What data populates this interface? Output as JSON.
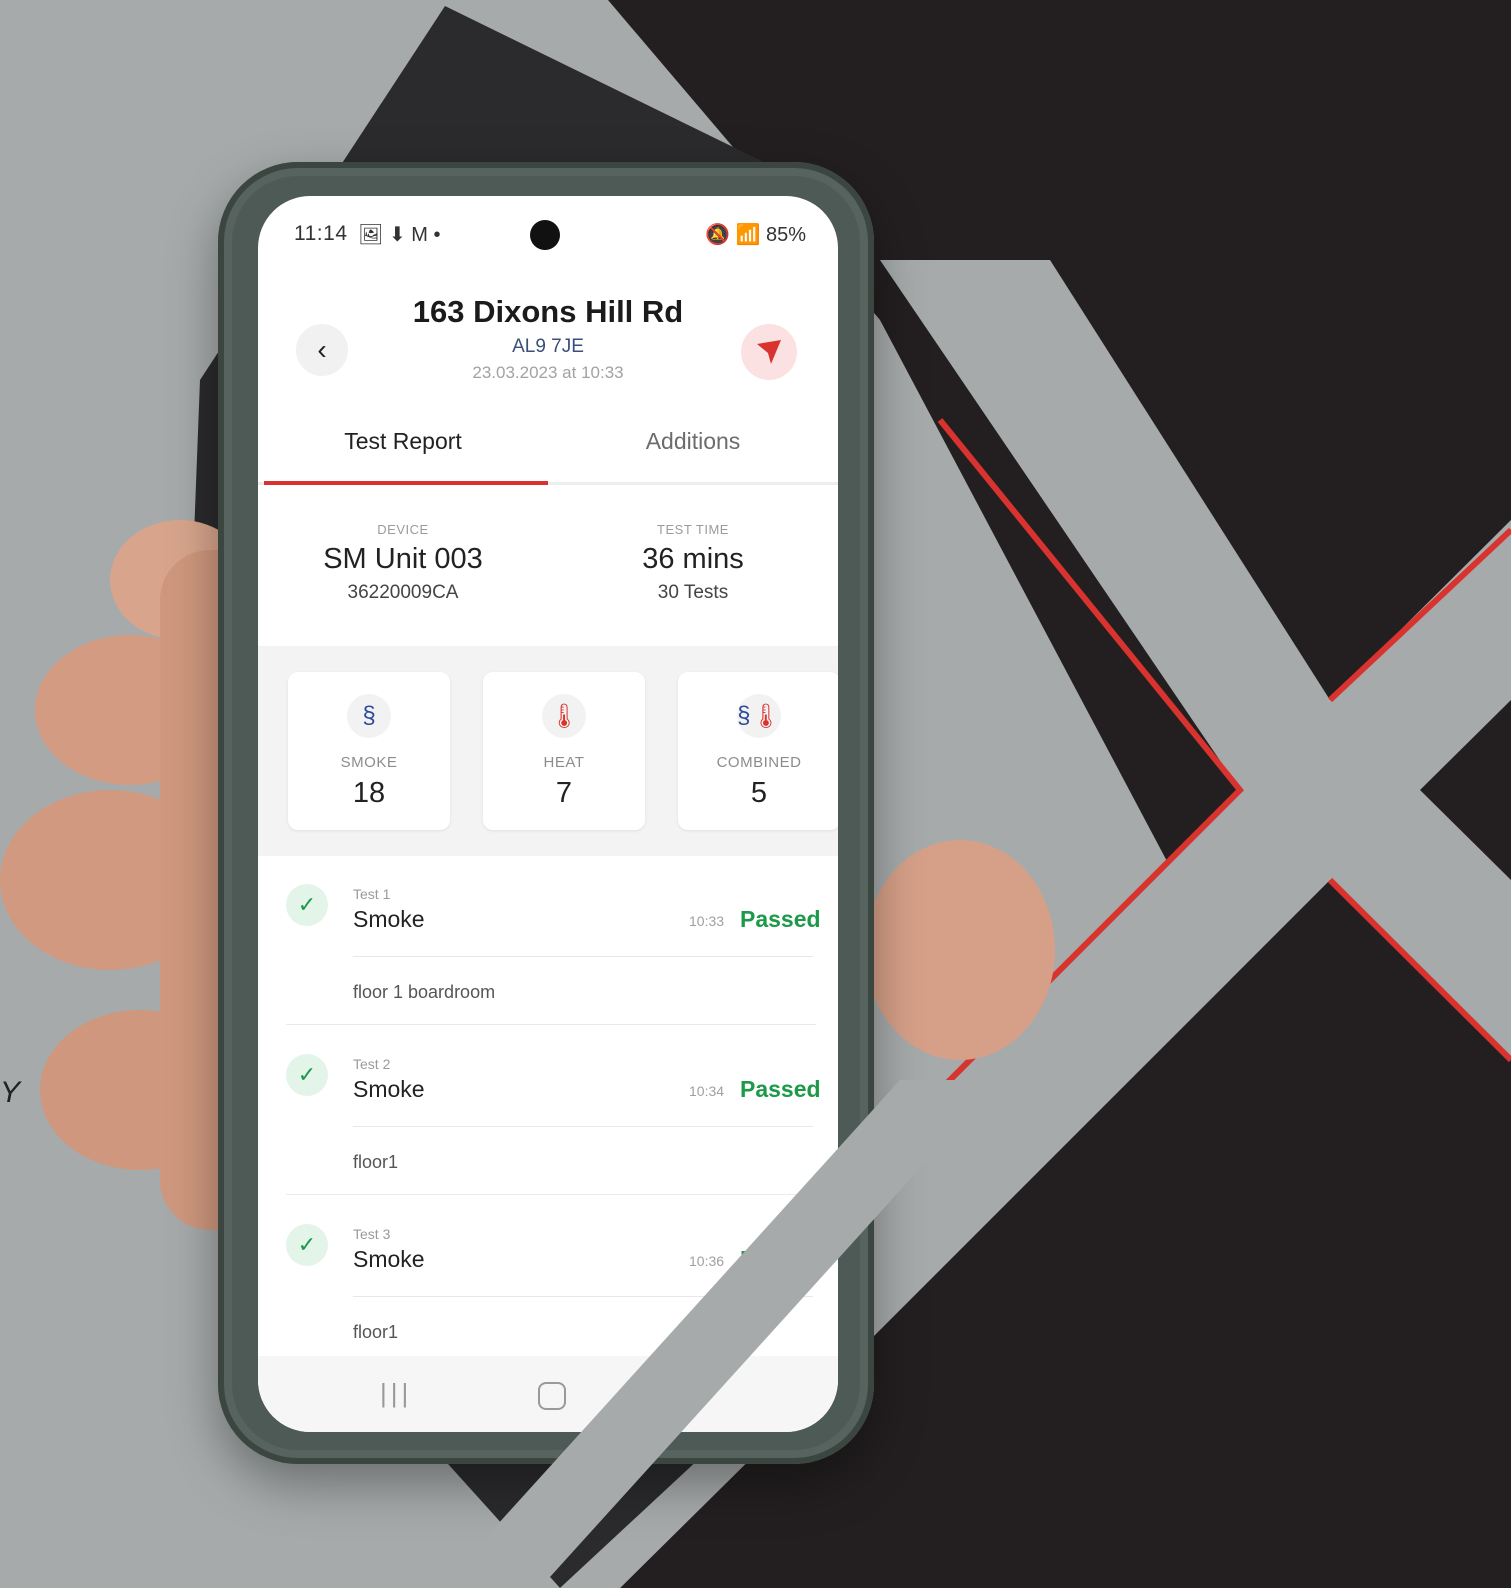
{
  "status_bar": {
    "time": "11:14",
    "left_icons": "🖼 ⬇ M •",
    "right_icons": "🔕 📶 85%"
  },
  "header": {
    "title": "163 Dixons Hill Rd",
    "postcode": "AL9 7JE",
    "datetime": "23.03.2023 at 10:33",
    "back_icon": "‹",
    "send_icon": "send-icon"
  },
  "tabs": [
    {
      "label": "Test Report",
      "active": true
    },
    {
      "label": "Additions",
      "active": false
    }
  ],
  "summary": {
    "device_label": "DEVICE",
    "device_name": "SM Unit 003",
    "device_serial": "36220009CA",
    "time_label": "TEST TIME",
    "time_value": "36 mins",
    "time_tests": "30 Tests"
  },
  "cards": [
    {
      "label": "SMOKE",
      "value": "18",
      "icon": "smoke-icon"
    },
    {
      "label": "HEAT",
      "value": "7",
      "icon": "thermometer-icon"
    },
    {
      "label": "COMBINED",
      "value": "5",
      "icon": "combined-icon"
    }
  ],
  "tests": [
    {
      "num": "Test 1",
      "type": "Smoke",
      "time": "10:33",
      "status": "Passed",
      "location": "floor 1 boardroom"
    },
    {
      "num": "Test 2",
      "type": "Smoke",
      "time": "10:34",
      "status": "Passed",
      "location": "floor1"
    },
    {
      "num": "Test 3",
      "type": "Smoke",
      "time": "10:36",
      "status": "Pa",
      "location": "floor1"
    }
  ],
  "nav": {
    "recent": "|||"
  },
  "side_text": "Y",
  "colors": {
    "accent": "#d9332f",
    "pass": "#1c9a4a",
    "background_grey": "#a6aaaa",
    "background_dark": "#231f20"
  }
}
